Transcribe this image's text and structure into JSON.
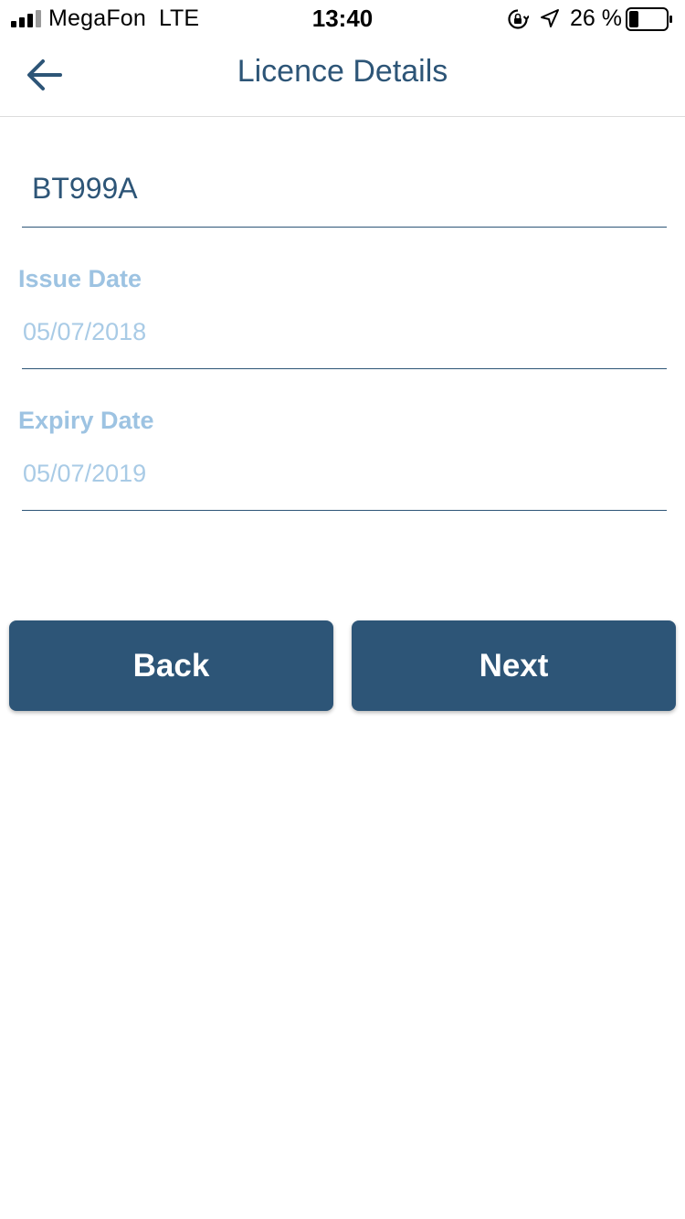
{
  "status_bar": {
    "carrier": "MegaFon",
    "network": "LTE",
    "time": "13:40",
    "battery_percent": "26 %",
    "battery_level": 0.26,
    "signal_bars": 4,
    "icons": [
      "signal-icon",
      "rotation-lock-icon",
      "location-arrow-icon",
      "battery-icon"
    ]
  },
  "nav": {
    "title": "Licence Details",
    "back_icon": "arrow-left-icon"
  },
  "form": {
    "licence_number": "BT999A",
    "issue_date": {
      "label": "Issue Date",
      "value": "05/07/2018"
    },
    "expiry_date": {
      "label": "Expiry Date",
      "value": "05/07/2019"
    }
  },
  "actions": {
    "back_label": "Back",
    "next_label": "Next"
  },
  "colors": {
    "primary": "#2d5577",
    "label": "#9dc3e2",
    "placeholder": "#a9cbe6",
    "background": "#ffffff"
  }
}
